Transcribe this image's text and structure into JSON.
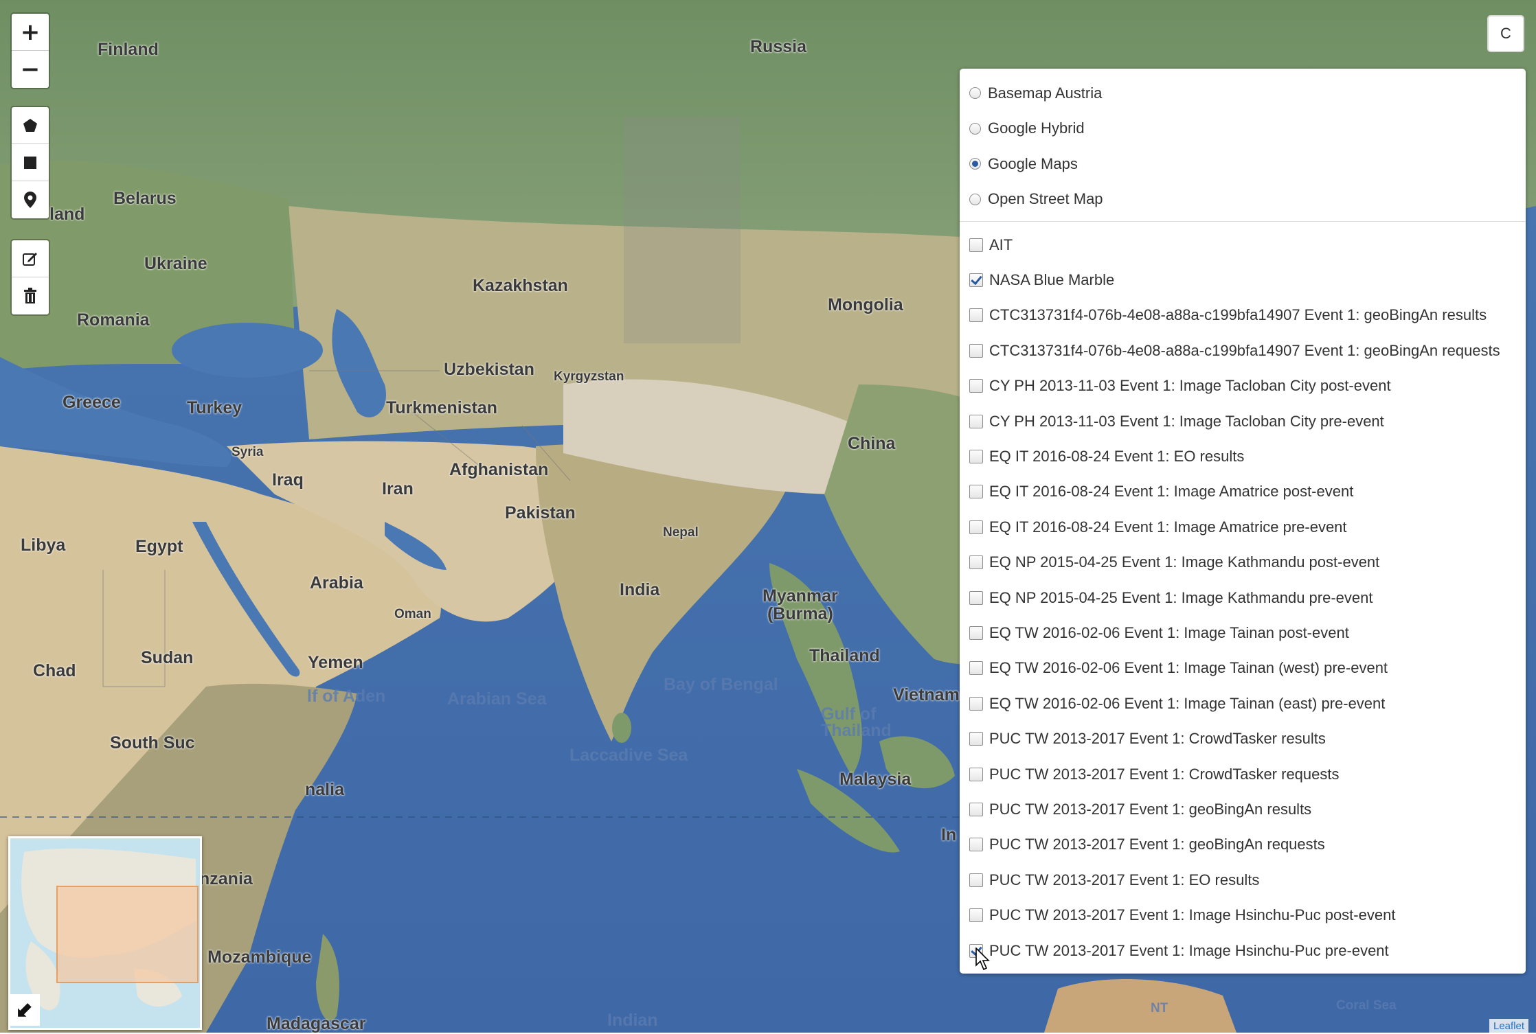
{
  "map": {
    "labels": {
      "finland": "Finland",
      "russia": "Russia",
      "belarus": "Belarus",
      "poland_partial": "land",
      "ukraine": "Ukraine",
      "romania": "Romania",
      "kazakhstan": "Kazakhstan",
      "mongolia": "Mongolia",
      "uzbekistan": "Uzbekistan",
      "kyrgyzstan": "Kyrgyzstan",
      "turkmenistan": "Turkmenistan",
      "greece": "Greece",
      "turkey": "Turkey",
      "syria": "Syria",
      "iraq": "Iraq",
      "iran": "Iran",
      "afghanistan": "Afghanistan",
      "pakistan": "Pakistan",
      "china": "China",
      "nepal": "Nepal",
      "libya": "Libya",
      "egypt": "Egypt",
      "arabia": "Arabia",
      "oman": "Oman",
      "india": "India",
      "myanmar": "Myanmar\n(Burma)",
      "chad": "Chad",
      "sudan": "Sudan",
      "yemen": "Yemen",
      "thailand": "Thailand",
      "vietnam": "Vietnam",
      "gulf_aden": "lf of Aden",
      "arabian_sea": "Arabian Sea",
      "bay_bengal": "Bay of Bengal",
      "gulf_thailand": "Gulf of\nThailand",
      "south_sudan": "South Suc",
      "somalia": "nalia",
      "laccadive": "Laccadive Sea",
      "malaysia": "Malaysia",
      "indonesia_partial": "In",
      "tanzania": "nzania",
      "mozambique": "Mozambique",
      "madagascar": "Madagascar",
      "indian": "Indian",
      "nt": "NT",
      "coral_sea": "Coral Sea"
    }
  },
  "controls": {
    "zoom_in": "+",
    "zoom_out": "−",
    "layer_toggle_label": "C",
    "minimap_toggle": "⬋",
    "icons": [
      "plus-icon",
      "minus-icon",
      "pentagon-icon",
      "square-icon",
      "marker-icon",
      "edit-icon",
      "trash-icon"
    ]
  },
  "layers": {
    "base": [
      {
        "label": "Basemap Austria",
        "selected": false
      },
      {
        "label": "Google Hybrid",
        "selected": false
      },
      {
        "label": "Google Maps",
        "selected": true
      },
      {
        "label": "Open Street Map",
        "selected": false
      }
    ],
    "overlays": [
      {
        "label": "AIT",
        "checked": false
      },
      {
        "label": "NASA Blue Marble",
        "checked": true
      },
      {
        "label": "CTC313731f4-076b-4e08-a88a-c199bfa14907 Event 1: geoBingAn results",
        "checked": false
      },
      {
        "label": "CTC313731f4-076b-4e08-a88a-c199bfa14907 Event 1: geoBingAn requests",
        "checked": false
      },
      {
        "label": "CY PH 2013-11-03 Event 1: Image Tacloban City post-event",
        "checked": false
      },
      {
        "label": "CY PH 2013-11-03 Event 1: Image Tacloban City pre-event",
        "checked": false
      },
      {
        "label": "EQ IT 2016-08-24 Event 1: EO results",
        "checked": false
      },
      {
        "label": "EQ IT 2016-08-24 Event 1: Image Amatrice post-event",
        "checked": false
      },
      {
        "label": "EQ IT 2016-08-24 Event 1: Image Amatrice pre-event",
        "checked": false
      },
      {
        "label": "EQ NP 2015-04-25 Event 1: Image Kathmandu post-event",
        "checked": false
      },
      {
        "label": "EQ NP 2015-04-25 Event 1: Image Kathmandu pre-event",
        "checked": false
      },
      {
        "label": "EQ TW 2016-02-06 Event 1: Image Tainan post-event",
        "checked": false
      },
      {
        "label": "EQ TW 2016-02-06 Event 1: Image Tainan (west) pre-event",
        "checked": false
      },
      {
        "label": "EQ TW 2016-02-06 Event 1: Image Tainan (east) pre-event",
        "checked": false
      },
      {
        "label": "PUC TW 2013-2017 Event 1: CrowdTasker results",
        "checked": false
      },
      {
        "label": "PUC TW 2013-2017 Event 1: CrowdTasker requests",
        "checked": false
      },
      {
        "label": "PUC TW 2013-2017 Event 1: geoBingAn results",
        "checked": false
      },
      {
        "label": "PUC TW 2013-2017 Event 1: geoBingAn requests",
        "checked": false
      },
      {
        "label": "PUC TW 2013-2017 Event 1: EO results",
        "checked": false
      },
      {
        "label": "PUC TW 2013-2017 Event 1: Image Hsinchu-Puc post-event",
        "checked": false
      },
      {
        "label": "PUC TW 2013-2017 Event 1: Image Hsinchu-Puc pre-event",
        "checked": true
      }
    ]
  },
  "attribution": "Leaflet",
  "colors": {
    "water": "#4f7fb8",
    "land_green": "#7f9a6a",
    "desert": "#d7c6a3",
    "accent": "#2a5aa0"
  }
}
